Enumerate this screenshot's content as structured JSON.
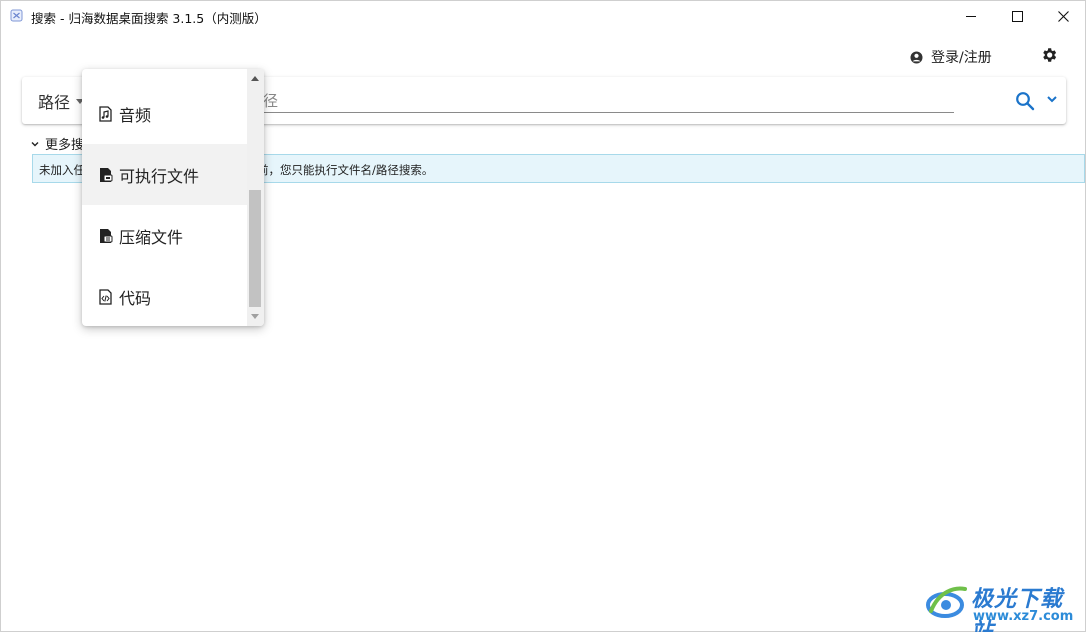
{
  "window": {
    "title": "搜索 - 归海数据桌面搜索 3.1.5（内测版）"
  },
  "header": {
    "login_label": "登录/注册",
    "settings_icon": "gear-icon",
    "user_icon": "user-circle-icon"
  },
  "search": {
    "scope_label": "路径",
    "placeholder": "路径"
  },
  "more_options": {
    "label": "更多搜"
  },
  "info_banner": {
    "text_start": "未加入任",
    "text_end": "前，您只能执行文件名/路径搜索。"
  },
  "dropdown": {
    "items": [
      {
        "label": "音频",
        "icon": "audio-file-icon"
      },
      {
        "label": "可执行文件",
        "icon": "executable-file-icon"
      },
      {
        "label": "压缩文件",
        "icon": "archive-file-icon"
      },
      {
        "label": "代码",
        "icon": "code-file-icon"
      }
    ],
    "hovered_item": "可执行文件"
  },
  "watermark": {
    "brand": "极光下载站",
    "url": "www.xz7.com"
  },
  "colors": {
    "accent": "#1a73c9",
    "banner_bg": "#e6f5fb",
    "banner_border": "#a7d9ea"
  }
}
